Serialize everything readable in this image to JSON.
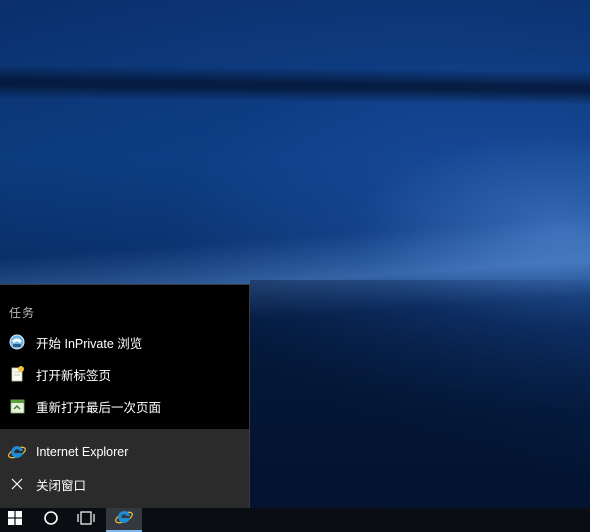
{
  "jumplist": {
    "section_header": "任务",
    "tasks": [
      {
        "label": "开始 InPrivate 浏览",
        "icon": "inprivate-icon"
      },
      {
        "label": "打开新标签页",
        "icon": "new-tab-icon"
      },
      {
        "label": "重新打开最后一次页面",
        "icon": "reopen-session-icon"
      }
    ],
    "pinned": [
      {
        "label": "Internet Explorer",
        "icon": "internet-explorer-icon"
      },
      {
        "label": "关闭窗口",
        "icon": "close-icon"
      }
    ]
  },
  "taskbar": {
    "buttons": [
      {
        "name": "start",
        "icon": "windows-logo-icon"
      },
      {
        "name": "search",
        "icon": "cortana-circle-icon"
      },
      {
        "name": "task-view",
        "icon": "task-view-icon"
      },
      {
        "name": "internet-explorer",
        "icon": "internet-explorer-icon",
        "active": true
      }
    ]
  },
  "colors": {
    "jumplist_bg": "#000000",
    "pinned_bg": "#2b2b2b",
    "taskbar_bg": "#0a0d12",
    "active_indicator": "#7fb6ea",
    "ie_blue": "#1e8bd6"
  }
}
